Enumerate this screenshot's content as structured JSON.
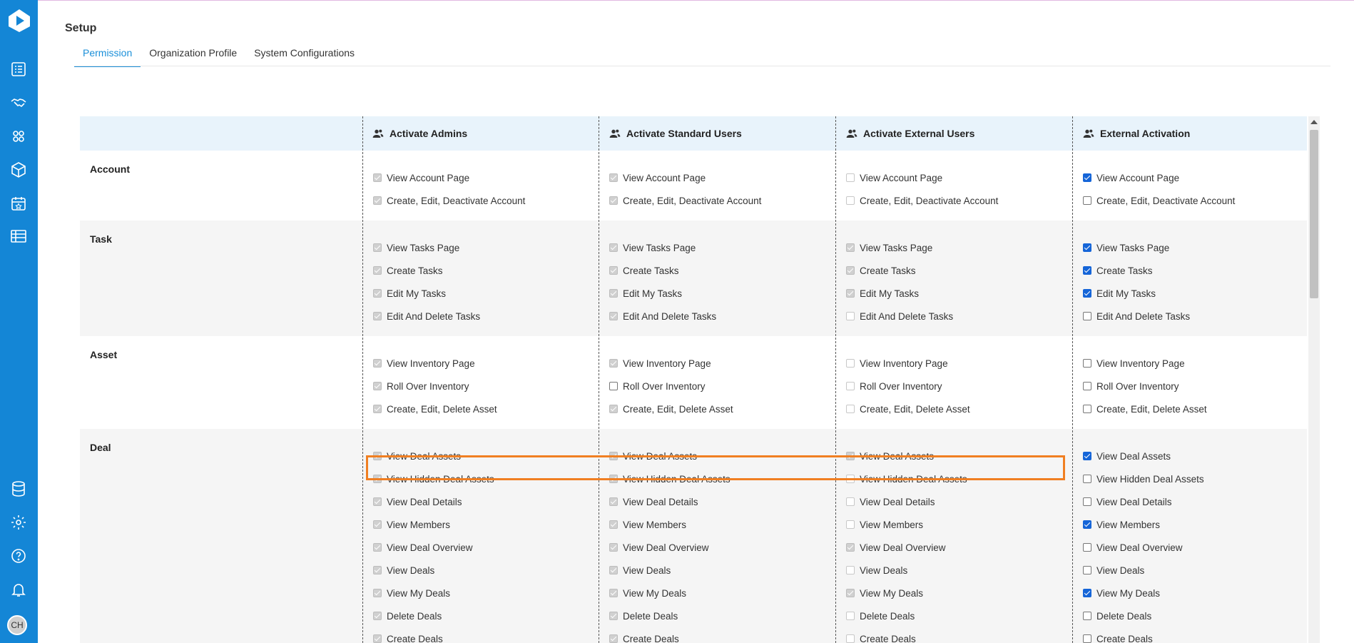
{
  "page": {
    "title": "Setup"
  },
  "tabs": [
    {
      "label": "Permission",
      "active": true
    },
    {
      "label": "Organization Profile",
      "active": false
    },
    {
      "label": "System Configurations",
      "active": false
    }
  ],
  "sidebar": {
    "top_icons": [
      "tasks-icon",
      "deals-handshake-icon",
      "teams-icon",
      "inventory-box-icon",
      "calendar-star-icon",
      "table-icon"
    ],
    "bottom_icons": [
      "database-icon",
      "settings-gear-icon",
      "help-icon",
      "notifications-bell-icon"
    ],
    "avatar_initials": "CH"
  },
  "columns": [
    {
      "label": "Activate Admins"
    },
    {
      "label": "Activate Standard Users"
    },
    {
      "label": "Activate External Users"
    },
    {
      "label": "External Activation"
    }
  ],
  "sections": [
    {
      "title": "Account",
      "permissions": [
        "View Account Page",
        "Create, Edit, Deactivate Account"
      ],
      "states": [
        [
          "on-gray",
          "on-gray"
        ],
        [
          "on-gray",
          "on-gray"
        ],
        [
          "off-light",
          "off-light"
        ],
        [
          "on-blue",
          "off-dark"
        ]
      ]
    },
    {
      "title": "Task",
      "permissions": [
        "View Tasks Page",
        "Create Tasks",
        "Edit My Tasks",
        "Edit And Delete Tasks"
      ],
      "states": [
        [
          "on-gray",
          "on-gray",
          "on-gray",
          "on-gray"
        ],
        [
          "on-gray",
          "on-gray",
          "on-gray",
          "on-gray"
        ],
        [
          "on-gray",
          "on-gray",
          "on-gray",
          "off-light"
        ],
        [
          "on-blue",
          "on-blue",
          "on-blue",
          "off-dark"
        ]
      ]
    },
    {
      "title": "Asset",
      "permissions": [
        "View Inventory Page",
        "Roll Over Inventory",
        "Create, Edit, Delete Asset"
      ],
      "states": [
        [
          "on-gray",
          "on-gray",
          "on-gray"
        ],
        [
          "on-gray",
          "off-dark",
          "on-gray"
        ],
        [
          "off-light",
          "off-light",
          "off-light"
        ],
        [
          "off-dark",
          "off-dark",
          "off-dark"
        ]
      ]
    },
    {
      "title": "Deal",
      "permissions": [
        "View Deal Assets",
        "View Hidden Deal Assets",
        "View Deal Details",
        "View Members",
        "View Deal Overview",
        "View Deals",
        "View My Deals",
        "Delete Deals",
        "Create Deals"
      ],
      "states": [
        [
          "on-gray",
          "on-gray",
          "on-gray",
          "on-gray",
          "on-gray",
          "on-gray",
          "on-gray",
          "on-gray",
          "on-gray"
        ],
        [
          "on-gray",
          "on-gray",
          "on-gray",
          "on-gray",
          "on-gray",
          "on-gray",
          "on-gray",
          "on-gray",
          "on-gray"
        ],
        [
          "on-gray",
          "off-light",
          "off-light",
          "off-light",
          "on-gray",
          "off-light",
          "on-gray",
          "off-light",
          "off-light"
        ],
        [
          "on-blue",
          "off-dark",
          "off-dark",
          "on-blue",
          "off-dark",
          "off-dark",
          "on-blue",
          "off-dark",
          "off-dark"
        ]
      ]
    }
  ],
  "colors": {
    "sidebar": "#1486d6",
    "accent": "#1a8fd9",
    "highlight": "#f07f22",
    "checked": "#1565d8"
  }
}
